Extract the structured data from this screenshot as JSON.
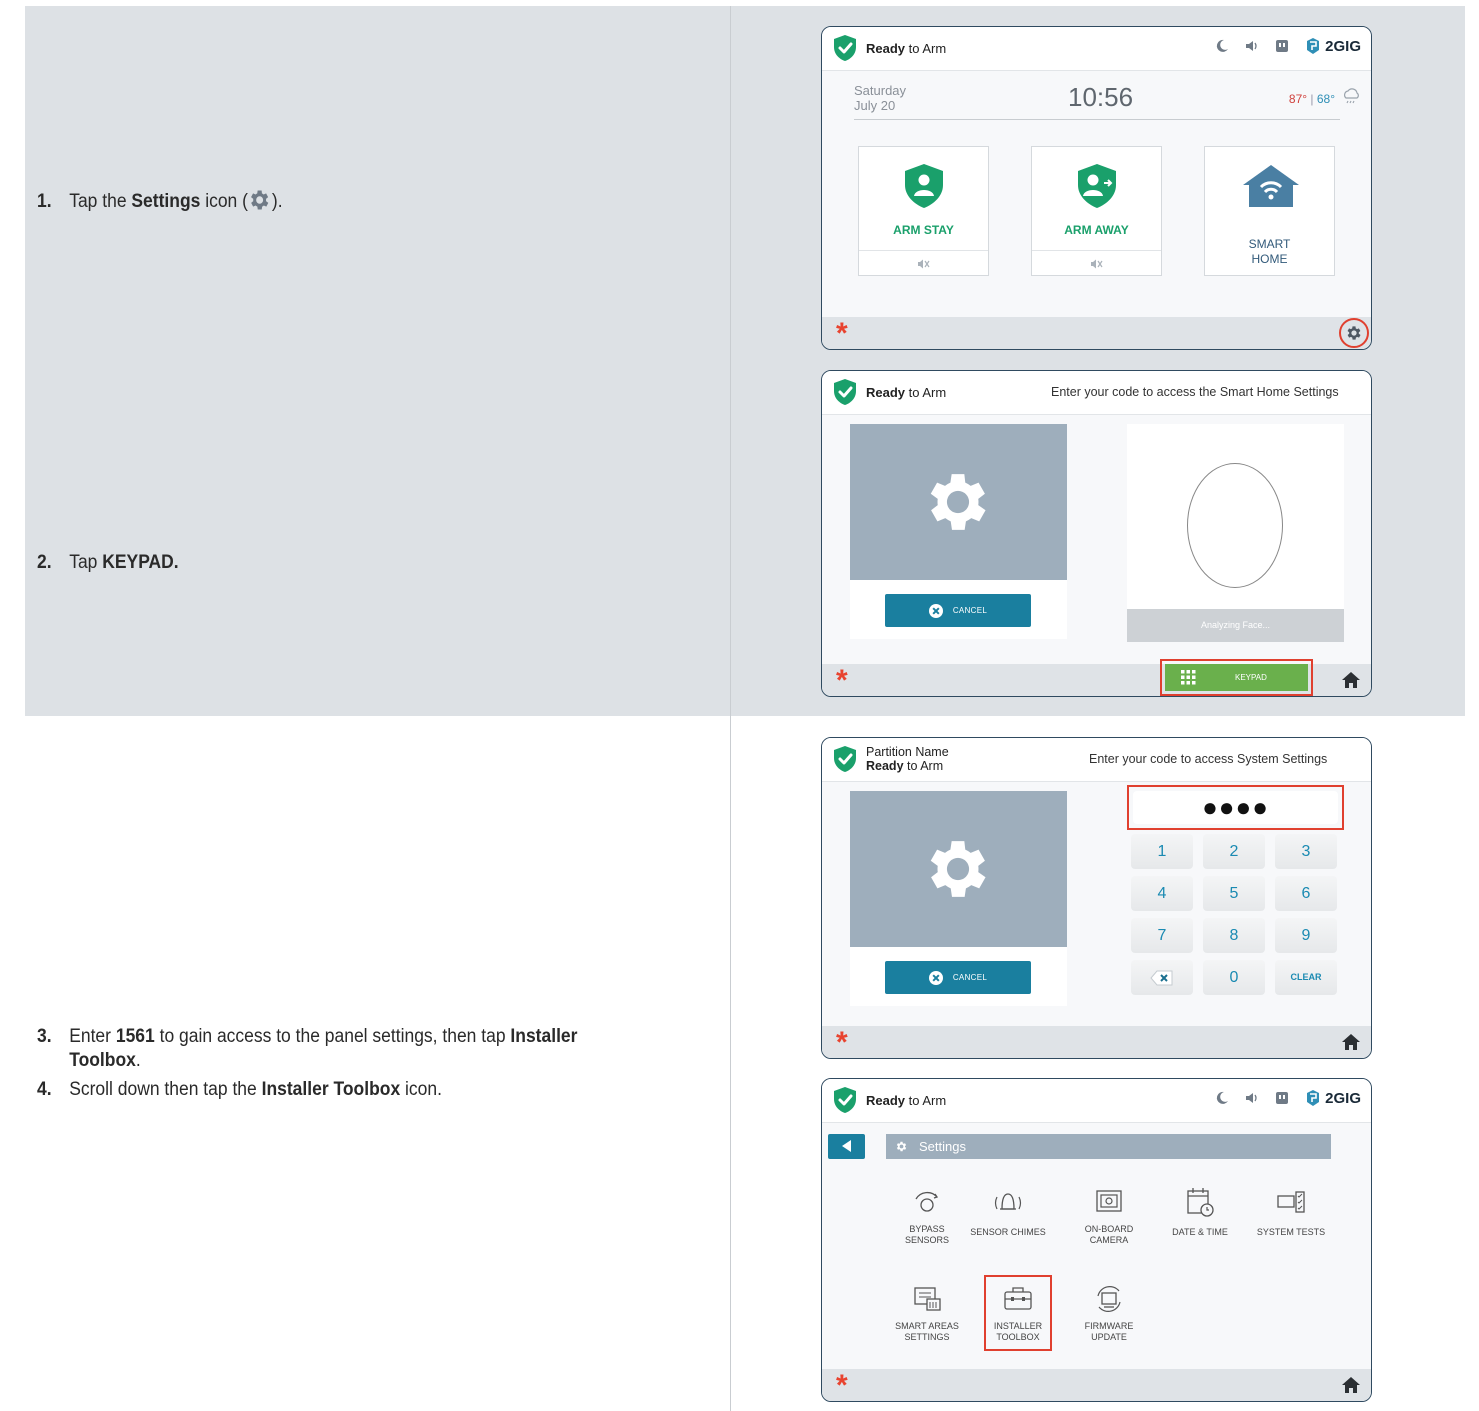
{
  "steps": [
    {
      "num": "1.",
      "pre": "Tap the ",
      "bold": "Settings",
      "post": " icon (",
      "end": ")."
    },
    {
      "num": "2.",
      "pre": "Tap ",
      "bold": "KEYPAD."
    },
    {
      "num": "3.",
      "pre": "Enter ",
      "bold": "1561",
      "mid": " to gain access to the panel settings, then tap ",
      "bold2": "Installer",
      "line2_bold": "Toolbox",
      "line2_end": "."
    },
    {
      "num": "4.",
      "pre": "Scroll down then tap the ",
      "bold": "Installer Toolbox",
      "post": " icon."
    }
  ],
  "status": {
    "ready_bold": "Ready",
    "ready_rest": " to Arm",
    "brand": "2GIG"
  },
  "panel1": {
    "day": "Saturday",
    "date": "July 20",
    "time": "10:56",
    "temp_high": "87°",
    "temp_sep": " | ",
    "temp_low": "68°",
    "tiles": {
      "arm_stay": "ARM STAY",
      "arm_away": "ARM AWAY",
      "smart_home_1": "SMART",
      "smart_home_2": "HOME"
    }
  },
  "panel2": {
    "title": "Enter your code to access the Smart Home Settings",
    "cancel": "CANCEL",
    "analyzing": "Analyzing Face...",
    "keypad": "KEYPAD"
  },
  "panel3": {
    "partition": "Partition Name",
    "title": "Enter your code to access System Settings",
    "code": "●●●●",
    "cancel": "CANCEL",
    "keys": [
      "1",
      "2",
      "3",
      "4",
      "5",
      "6",
      "7",
      "8",
      "9",
      "",
      "0",
      "CLEAR"
    ]
  },
  "panel4": {
    "settings_title": "Settings",
    "items": [
      {
        "l1": "BYPASS",
        "l2": "SENSORS"
      },
      {
        "l1": "SENSOR CHIMES",
        "l2": ""
      },
      {
        "l1": "ON-BOARD",
        "l2": "CAMERA"
      },
      {
        "l1": "DATE & TIME",
        "l2": ""
      },
      {
        "l1": "SYSTEM TESTS",
        "l2": ""
      },
      {
        "l1": "SMART AREAS",
        "l2": "SETTINGS"
      },
      {
        "l1": "INSTALLER",
        "l2": "TOOLBOX"
      },
      {
        "l1": "FIRMWARE",
        "l2": "UPDATE"
      }
    ]
  },
  "colors": {
    "accent_green": "#1aa06b",
    "highlight_red": "#e0402f",
    "button_teal": "#1a7f9f",
    "keypad_green": "#6ab04c"
  }
}
